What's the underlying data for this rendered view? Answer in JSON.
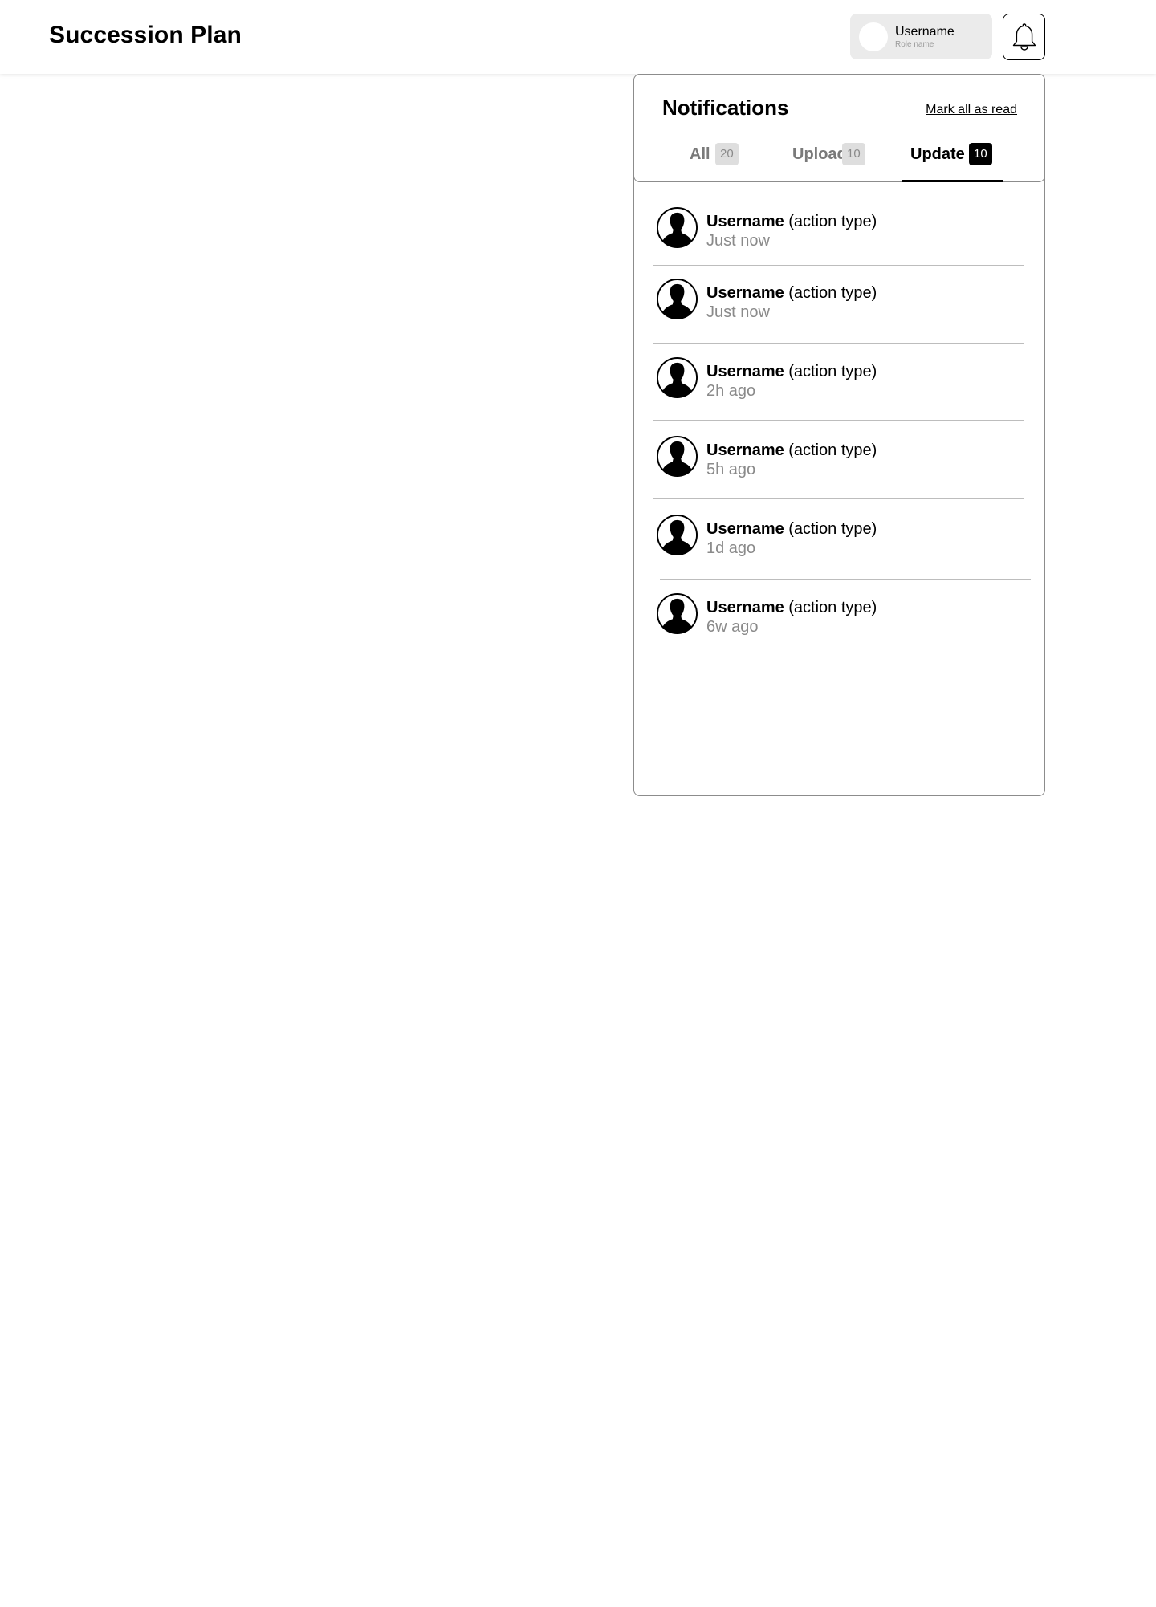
{
  "header": {
    "title": "Succession Plan",
    "user": {
      "name": "Username",
      "role": "Role name"
    },
    "bell_icon": "bell-icon"
  },
  "notifications": {
    "title": "Notifications",
    "mark_all_label": "Mark all as read",
    "tabs": [
      {
        "label": "All",
        "count": "20",
        "active": false
      },
      {
        "label": "Upload",
        "count": "10",
        "active": false
      },
      {
        "label": "Update",
        "count": "10",
        "active": true
      }
    ],
    "items": [
      {
        "user": "Username",
        "action": " (action type)",
        "time": "Just now",
        "avatar_icon": "user-silhouette-icon"
      },
      {
        "user": "Username",
        "action": " (action type)",
        "time": "Just now",
        "avatar_icon": "user-silhouette-icon"
      },
      {
        "user": "Username",
        "action": " (action type)",
        "time": "2h ago",
        "avatar_icon": "user-silhouette-icon"
      },
      {
        "user": "Username",
        "action": " (action type)",
        "time": "5h ago",
        "avatar_icon": "user-silhouette-icon"
      },
      {
        "user": "Username",
        "action": " (action type)",
        "time": "1d ago",
        "avatar_icon": "user-silhouette-icon"
      },
      {
        "user": "Username",
        "action": " (action type)",
        "time": "6w ago",
        "avatar_icon": "user-silhouette-icon"
      }
    ]
  },
  "colors": {
    "background": "#ffffff",
    "chip": "#ebebeb",
    "muted_text": "#8a8a8a",
    "active_badge": "#000000",
    "inactive_badge": "#dedede",
    "border": "#8c8c8c"
  }
}
